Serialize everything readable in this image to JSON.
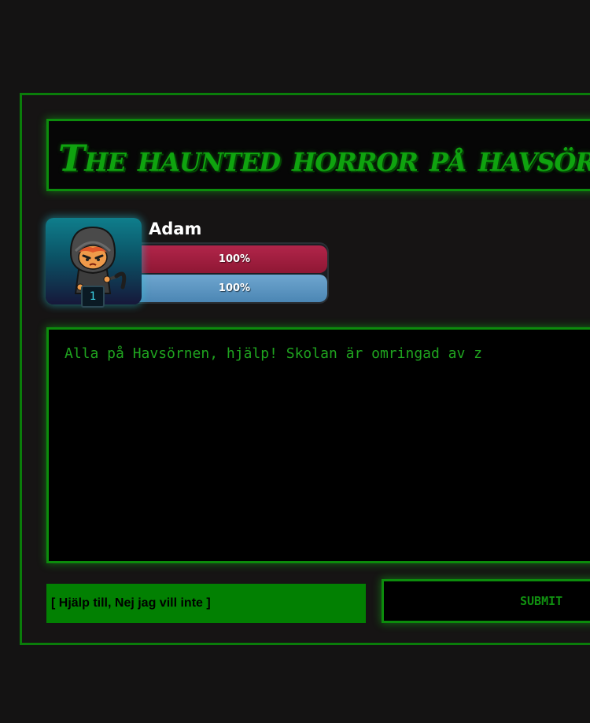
{
  "game": {
    "title": "The haunted horror på havsörnen"
  },
  "player": {
    "name": "Adam",
    "level": "1",
    "avatar_icon": "hooded-reaper-character-icon",
    "health": {
      "label": "100%",
      "value": 1.0,
      "color": "#a11f40"
    },
    "energy": {
      "label": "100%",
      "value": 1.0,
      "color": "#5d95c2"
    }
  },
  "story": {
    "text": "Alla på Havsörnen, hjälp! Skolan är omringad av z"
  },
  "answer": {
    "placeholder": "[ Hjälp till, Nej jag vill inte ]"
  },
  "submit": {
    "label": "SUBMIT"
  },
  "colors": {
    "accent_green": "#0c8c0c",
    "background": "#141313"
  }
}
